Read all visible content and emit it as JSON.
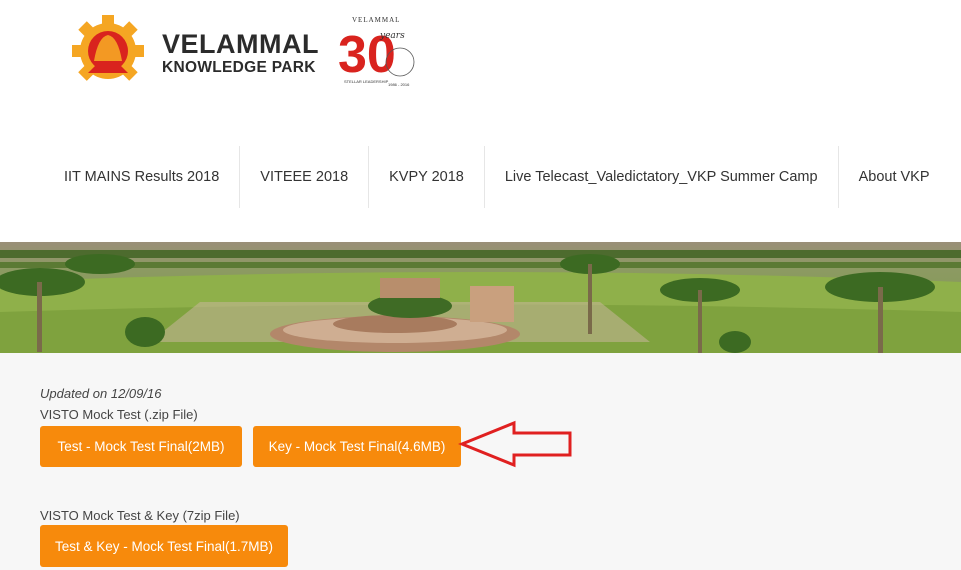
{
  "header": {
    "logo_line1": "VELAMMAL",
    "logo_line2": "KNOWLEDGE PARK",
    "anniversary": {
      "top_text": "VELAMMAL",
      "number": "30",
      "script": "years",
      "tagline": "STELLAR LEADERSHIP",
      "range": "1986 - 2016"
    }
  },
  "nav": {
    "items": [
      {
        "label": "IIT MAINS Results 2018"
      },
      {
        "label": "VITEEE 2018"
      },
      {
        "label": "KVPY 2018"
      },
      {
        "label": "Live Telecast_Valedictatory_VKP Summer Camp"
      },
      {
        "label": "About VKP"
      }
    ]
  },
  "content": {
    "updated": "Updated on 12/09/16",
    "section1_label": "VISTO Mock Test (.zip File)",
    "btn_test": "Test - Mock Test Final(2MB)",
    "btn_key": "Key - Mock Test Final(4.6MB)",
    "section2_label": "VISTO Mock Test & Key (7zip File)",
    "btn_testkey": "Test & Key - Mock Test Final(1.7MB)"
  },
  "colors": {
    "button": "#f78a0c",
    "arrow": "#e02020",
    "logo_red": "#d9231e",
    "logo_orange": "#f5a623"
  }
}
